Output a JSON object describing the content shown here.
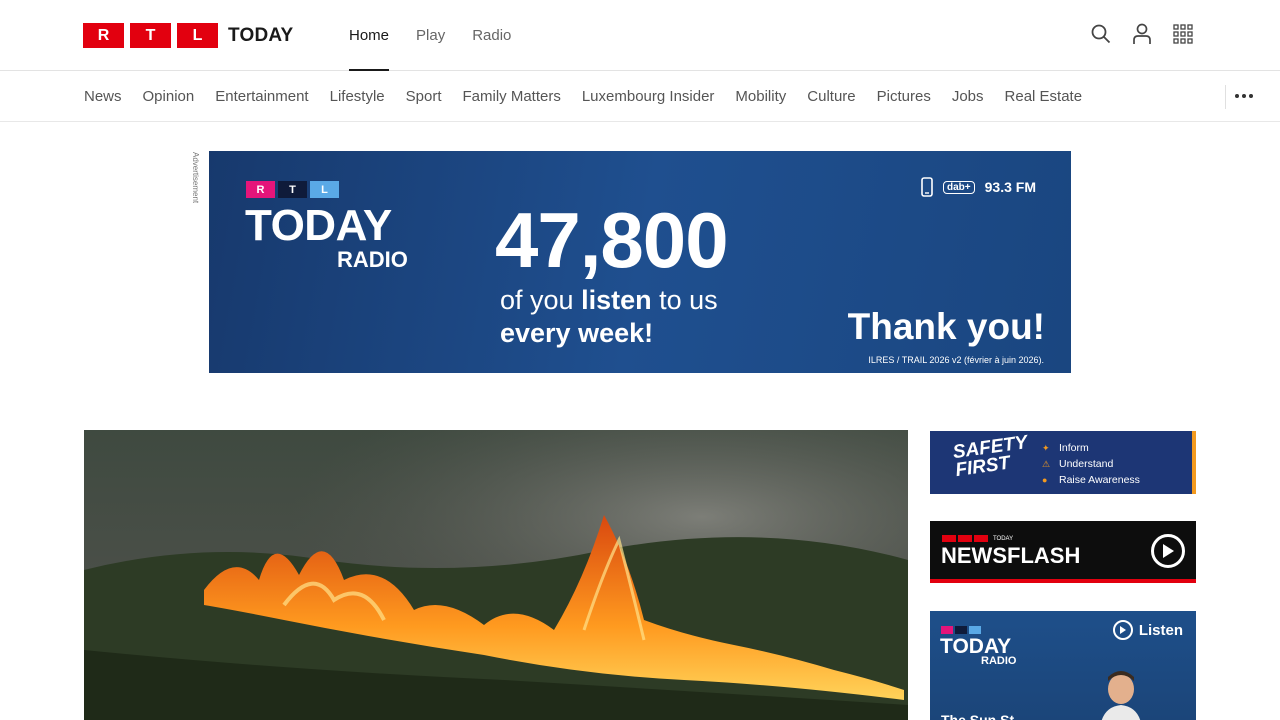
{
  "brand": {
    "logo_letters": [
      "R",
      "T",
      "L"
    ],
    "logo_word": "TODAY",
    "accent_color": "#e2000f"
  },
  "main_nav": [
    {
      "label": "Home",
      "active": true
    },
    {
      "label": "Play",
      "active": false
    },
    {
      "label": "Radio",
      "active": false
    }
  ],
  "tools": [
    "search-icon",
    "user-icon",
    "apps-grid-icon"
  ],
  "sections": [
    "News",
    "Opinion",
    "Entertainment",
    "Lifestyle",
    "Sport",
    "Family Matters",
    "Luxembourg Insider",
    "Mobility",
    "Culture",
    "Pictures",
    "Jobs",
    "Real Estate"
  ],
  "ad": {
    "label": "Advertisement",
    "logo_letters": [
      "R",
      "T",
      "L"
    ],
    "today": "TODAY",
    "radio": "RADIO",
    "number": "47,800",
    "line1_pre": "of you ",
    "line1_bold": "listen",
    "line1_post": " to us",
    "line2": "every week!",
    "dab": "dab+",
    "frequency": "93.3 FM",
    "thanks": "Thank you!",
    "source": "ILRES / TRAIL 2026 v2 (février à juin 2026)."
  },
  "safety": {
    "title_1": "SAFETY",
    "title_2": "FIRST",
    "items": [
      "Inform",
      "Understand",
      "Raise Awareness"
    ]
  },
  "newsflash": {
    "mini": "TODAY",
    "title": "NEWSFLASH"
  },
  "radio_promo": {
    "today": "TODAY",
    "radio": "RADIO",
    "listen": "Listen",
    "show": "The Sun St"
  }
}
